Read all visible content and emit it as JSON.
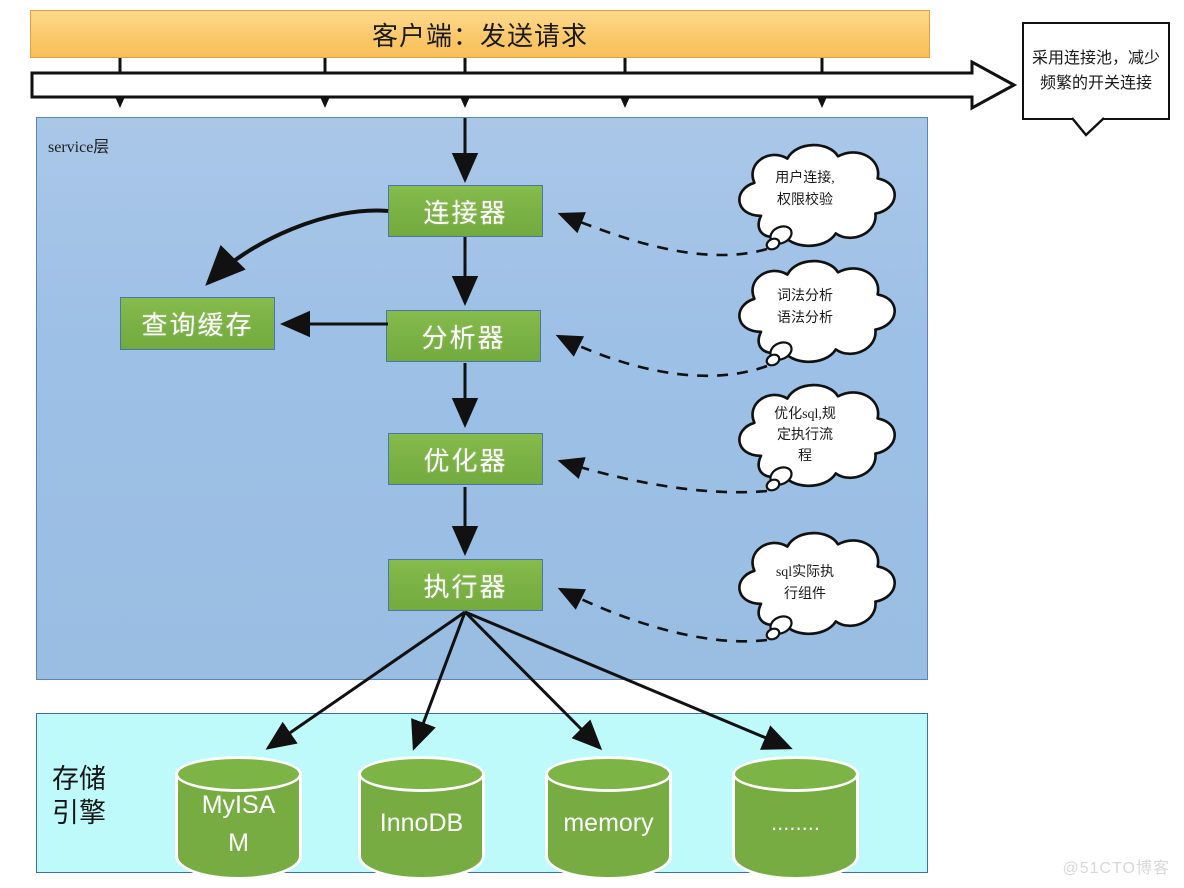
{
  "client": {
    "label": "客户端：发送请求"
  },
  "connection_pool_callout": {
    "text": "采用连接池，减少频繁的开关连接"
  },
  "service_layer": {
    "label": "service层",
    "boxes": [
      {
        "id": "connector",
        "label": "连接器"
      },
      {
        "id": "query-cache",
        "label": "查询缓存"
      },
      {
        "id": "analyzer",
        "label": "分析器"
      },
      {
        "id": "optimizer",
        "label": "优化器"
      },
      {
        "id": "executor",
        "label": "执行器"
      }
    ],
    "clouds": [
      {
        "id": "connector-note",
        "lines": [
          "用户连接,",
          "权限校验"
        ]
      },
      {
        "id": "analyzer-note",
        "lines": [
          "词法分析",
          "语法分析"
        ]
      },
      {
        "id": "optimizer-note",
        "lines": [
          "优化sql,规",
          "定执行流",
          "程"
        ]
      },
      {
        "id": "executor-note",
        "lines": [
          "sql实际执",
          "行组件"
        ]
      }
    ]
  },
  "storage_layer": {
    "label_lines": [
      "存储",
      "引擎"
    ],
    "engines": [
      {
        "id": "myisam",
        "lines": [
          "MyISA",
          "M"
        ]
      },
      {
        "id": "innodb",
        "lines": [
          "InnoDB"
        ]
      },
      {
        "id": "memory",
        "lines": [
          "memory"
        ]
      },
      {
        "id": "others",
        "lines": [
          "........"
        ]
      }
    ]
  },
  "watermark": "@51CTO博客",
  "colors": {
    "client_fill": "#fbc96a",
    "service_fill": "#9dc0e6",
    "storage_fill": "#bdfaf9",
    "process_fill": "#79b043",
    "stroke": "#111111"
  }
}
